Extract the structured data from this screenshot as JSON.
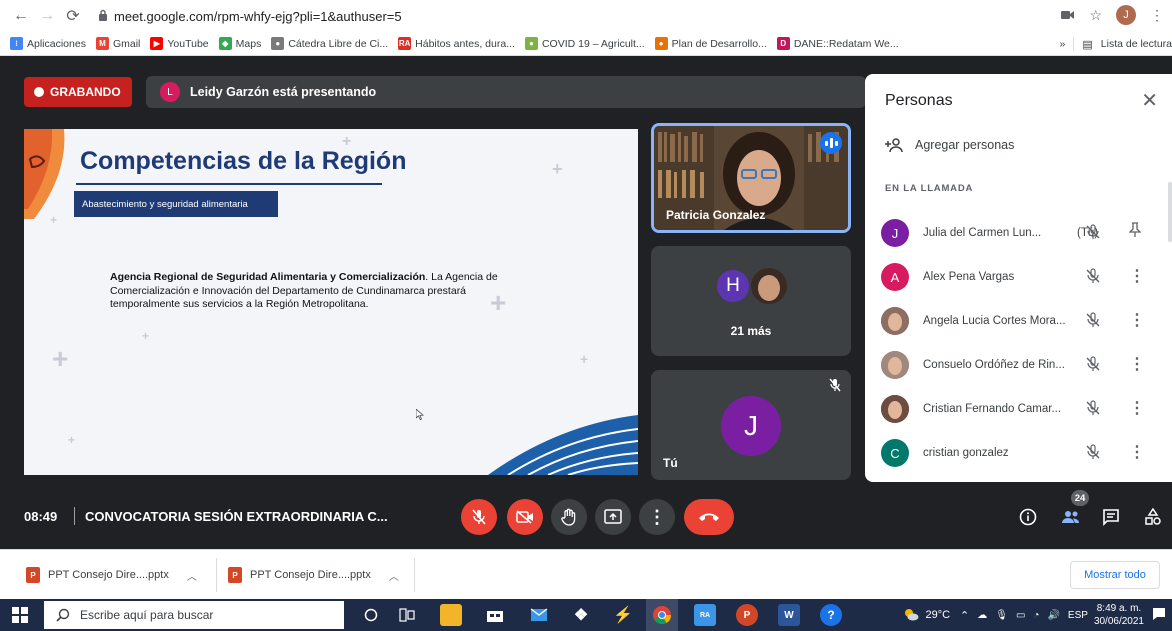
{
  "browser": {
    "url": "meet.google.com/rpm-whfy-ejg?pli=1&authuser=5",
    "profile_initial": "J",
    "bookmarks": [
      {
        "label": "Aplicaciones",
        "color": "#4285f4",
        "glyph": "⁝"
      },
      {
        "label": "Gmail",
        "color": "#ea4335",
        "glyph": "M"
      },
      {
        "label": "YouTube",
        "color": "#ff0000",
        "glyph": "▶"
      },
      {
        "label": "Maps",
        "color": "#34a853",
        "glyph": "◆"
      },
      {
        "label": "Cátedra Libre de Ci...",
        "color": "#7a7a7a",
        "glyph": "●"
      },
      {
        "label": "Hábitos antes, dura...",
        "color": "#d93025",
        "glyph": "RA"
      },
      {
        "label": "COVID 19 – Agricult...",
        "color": "#7cb342",
        "glyph": "●"
      },
      {
        "label": "Plan de Desarrollo...",
        "color": "#e8710a",
        "glyph": "●"
      },
      {
        "label": "DANE::Redatam We...",
        "color": "#c2185b",
        "glyph": "D"
      }
    ],
    "bookmarks_overflow": "»",
    "reading_list": "Lista de lectura"
  },
  "meet": {
    "recording_label": "GRABANDO",
    "presenter_initial": "L",
    "presenter_text": "Leidy Garzón está presentando",
    "slide": {
      "title": "Competencias de la Región",
      "subtitle": "Abastecimiento y seguridad alimentaria",
      "body_bold": "Agencia Regional de Seguridad Alimentaria y Comercialización",
      "body_rest": ". La Agencia de Comercialización e Innovación del Departamento de Cundinamarca prestará temporalmente sus servicios a la Región Metropolitana."
    },
    "tiles": {
      "speaker_name": "Patricia Gonzalez",
      "more_initial": "H",
      "more_label": "21 más",
      "self_initial": "J",
      "self_label": "Tú"
    },
    "people_panel": {
      "title": "Personas",
      "add_label": "Agregar personas",
      "section_label": "EN LA LLAMADA",
      "participants": [
        {
          "name": "Julia del Carmen Lun...",
          "suffix": "(Tú)",
          "initial": "J",
          "color": "#7b1fa2",
          "photo": false
        },
        {
          "name": "Alex Pena Vargas",
          "suffix": "",
          "initial": "A",
          "color": "#d81b60",
          "photo": false
        },
        {
          "name": "Angela Lucia Cortes Mora...",
          "suffix": "",
          "initial": "",
          "color": "#8d6e63",
          "photo": true
        },
        {
          "name": "Consuelo Ordóñez de Rin...",
          "suffix": "",
          "initial": "",
          "color": "#a1887f",
          "photo": true
        },
        {
          "name": "Cristian Fernando Camar...",
          "suffix": "",
          "initial": "",
          "color": "#6d4c41",
          "photo": true
        },
        {
          "name": "cristian gonzalez",
          "suffix": "",
          "initial": "C",
          "color": "#00796b",
          "photo": false
        }
      ]
    },
    "bottom": {
      "time": "08:49",
      "meeting_title": "CONVOCATORIA SESIÓN EXTRAORDINARIA C...",
      "people_count": "24"
    }
  },
  "downloads": {
    "items": [
      {
        "filename": "PPT Consejo Dire....pptx"
      },
      {
        "filename": "PPT Consejo Dire....pptx"
      }
    ],
    "show_all": "Mostrar todo"
  },
  "taskbar": {
    "search_placeholder": "Escribe aquí para buscar",
    "weather": "29°C",
    "language": "ESP",
    "time": "8:49 a. m.",
    "date": "30/06/2021"
  }
}
